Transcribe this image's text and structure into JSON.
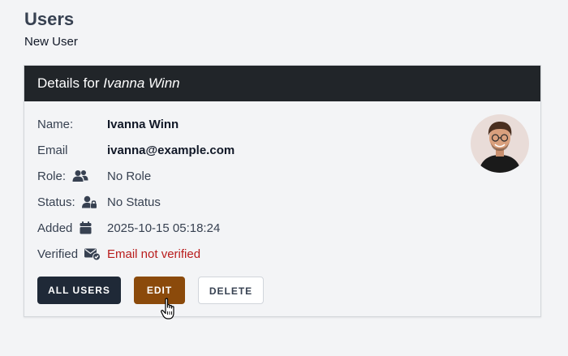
{
  "header": {
    "title": "Users",
    "subtitle": "New User"
  },
  "card": {
    "title_prefix": "Details for",
    "user_name": "Ivanna Winn"
  },
  "details": {
    "name_label": "Name:",
    "name_value": "Ivanna Winn",
    "email_label": "Email",
    "email_value": "ivanna@example.com",
    "role_label": "Role:",
    "role_value": "No Role",
    "status_label": "Status:",
    "status_value": "No Status",
    "added_label": "Added",
    "added_value": "2025-10-15 05:18:24",
    "verified_label": "Verified",
    "verified_value": "Email not verified"
  },
  "buttons": {
    "all_users": "ALL USERS",
    "edit": "EDIT",
    "delete": "DELETE"
  },
  "icons": {
    "role": "users-icon",
    "status": "user-lock-icon",
    "added": "calendar-icon",
    "verified": "envelope-check-icon",
    "avatar": "avatar",
    "cursor": "hand-pointer-icon"
  },
  "colors": {
    "header_bg": "#212529",
    "primary_btn": "#1f2937",
    "edit_btn": "#8b4a0b",
    "danger_text": "#b91c1c"
  }
}
